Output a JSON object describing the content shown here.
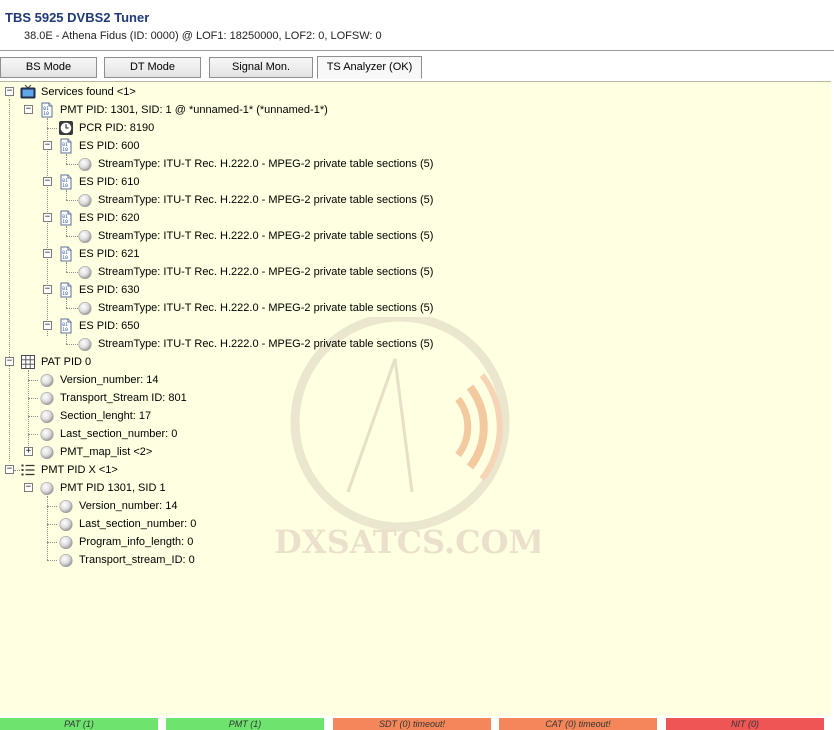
{
  "window": {
    "title": "TBS 5925 DVBS2 Tuner",
    "subtitle": "38.0E - Athena Fidus (ID: 0000) @ LOF1: 18250000, LOF2: 0, LOFSW: 0"
  },
  "tabs": [
    {
      "label": "BS Mode"
    },
    {
      "label": "DT Mode"
    },
    {
      "label": "Signal Mon."
    },
    {
      "label": "TS Analyzer (OK)"
    }
  ],
  "tree": {
    "services": {
      "label": "Services found <1>",
      "pmt": {
        "label": "PMT PID: 1301, SID: 1 @ *unnamed-1* (*unnamed-1*)",
        "pcr": "PCR PID: 8190",
        "es": [
          {
            "label": "ES PID: 600",
            "stream": "StreamType: ITU-T Rec. H.222.0 - MPEG-2 private table sections (5)"
          },
          {
            "label": "ES PID: 610",
            "stream": "StreamType: ITU-T Rec. H.222.0 - MPEG-2 private table sections (5)"
          },
          {
            "label": "ES PID: 620",
            "stream": "StreamType: ITU-T Rec. H.222.0 - MPEG-2 private table sections (5)"
          },
          {
            "label": "ES PID: 621",
            "stream": "StreamType: ITU-T Rec. H.222.0 - MPEG-2 private table sections (5)"
          },
          {
            "label": "ES PID: 630",
            "stream": "StreamType: ITU-T Rec. H.222.0 - MPEG-2 private table sections (5)"
          },
          {
            "label": "ES PID: 650",
            "stream": "StreamType: ITU-T Rec. H.222.0 - MPEG-2 private table sections (5)"
          }
        ]
      }
    },
    "pat": {
      "label": "PAT PID 0",
      "items": [
        "Version_number: 14",
        "Transport_Stream ID: 801",
        "Section_lenght: 17",
        "Last_section_number: 0"
      ],
      "map": "PMT_map_list <2>"
    },
    "pmtx": {
      "label": "PMT PID X <1>",
      "child": {
        "label": "PMT PID 1301, SID 1",
        "items": [
          "Version_number: 14",
          "Last_section_number: 0",
          "Program_info_length: 0",
          "Transport_stream_ID: 0"
        ]
      }
    }
  },
  "watermark": "DXSATCS.COM",
  "status": [
    {
      "label": "PAT (1)",
      "color": "#6ee36e"
    },
    {
      "label": "PMT (1)",
      "color": "#6ee36e"
    },
    {
      "label": "SDT (0) timeout!",
      "color": "#f4875a"
    },
    {
      "label": "CAT (0) timeout!",
      "color": "#f4875a"
    },
    {
      "label": "NIT (0)",
      "color": "#ee5656"
    }
  ]
}
